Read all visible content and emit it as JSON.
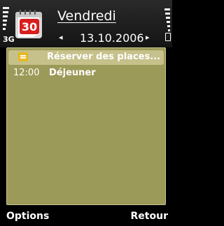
{
  "status": {
    "network": "3G",
    "signal_level": 0.8,
    "battery_level": 0.85
  },
  "header": {
    "icon_day_number": "30",
    "weekday": "Vendredi",
    "date": "13.10.2006",
    "prev_arrow": "◂",
    "next_arrow": "▸",
    "calendar_icon": "calendar-icon"
  },
  "entries": [
    {
      "icon": "memo-icon",
      "time": "",
      "title": "Réserver des places..."
    },
    {
      "icon": "",
      "time": "12:00",
      "title": "Déjeuner"
    }
  ],
  "softkeys": {
    "left": "Options",
    "right": "Retour"
  },
  "colors": {
    "list_bg": "#9c9a58",
    "selection": "#c6c08a",
    "memo_icon": "#e8b820"
  }
}
